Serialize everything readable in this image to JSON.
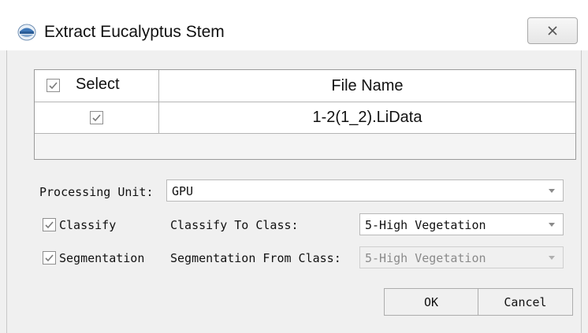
{
  "window": {
    "title": "Extract Eucalyptus Stem",
    "close_label": "✕"
  },
  "table": {
    "columns": [
      "Select",
      "File Name"
    ],
    "header_select_checked": true,
    "rows": [
      {
        "selected": true,
        "file_name": "1-2(1_2).LiData"
      }
    ]
  },
  "form": {
    "processing_unit": {
      "label": "Processing Unit:",
      "value": "GPU"
    },
    "classify": {
      "checked": true,
      "label": "Classify",
      "target_label": "Classify To Class:",
      "target_value": "5-High Vegetation"
    },
    "segmentation": {
      "checked": true,
      "label": "Segmentation",
      "source_label": "Segmentation From Class:",
      "source_value": "5-High Vegetation",
      "source_enabled": false
    }
  },
  "buttons": {
    "ok": "OK",
    "cancel": "Cancel"
  },
  "icons": {
    "app": "app-logo-icon",
    "close": "close-icon",
    "check": "check-icon",
    "dropdown": "chevron-down-icon"
  }
}
